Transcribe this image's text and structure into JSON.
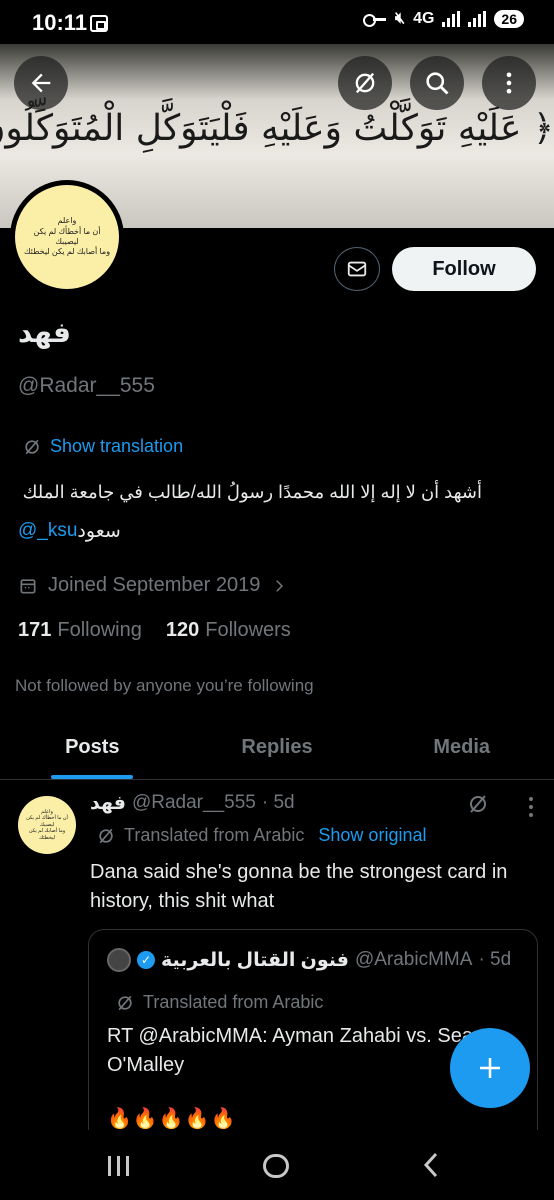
{
  "status_bar": {
    "time": "10:11",
    "network": "4G",
    "battery": "26"
  },
  "banner": {
    "calligraphy": "﴿ عَلَيْهِ تَوَكَّلْتُ وَعَلَيْهِ فَلْيَتَوَكَّلِ الْمُتَوَكِّلُونَ ﴾"
  },
  "avatar": {
    "line1": "واعلم",
    "line2": "أن ما أخطأك لم يكن ليصيبك",
    "line3": "وما أصابك لم يكن ليخطئك"
  },
  "profile": {
    "follow_label": "Follow",
    "name": "فهد",
    "handle": "@Radar__555",
    "show_translation": "Show translation",
    "bio_line1": "أشهد أن لا إله إلا الله محمدًا رسولُ الله/طالب في جامعة الملك",
    "bio_mention": "@_ksu",
    "bio_line2_suffix": "سعود",
    "joined": "Joined September 2019",
    "following_count": "171",
    "following_label": "Following",
    "followers_count": "120",
    "followers_label": "Followers",
    "not_followed": "Not followed by anyone you’re following"
  },
  "tabs": [
    {
      "label": "Posts",
      "active": true
    },
    {
      "label": "Replies",
      "active": false
    },
    {
      "label": "Media",
      "active": false
    }
  ],
  "tweet": {
    "name": "فهد",
    "handle": "@Radar__555",
    "time": "· 5d",
    "translated_from": "Translated from Arabic",
    "show_original": "Show original",
    "text": "Dana said she's gonna be the strongest card in history, this shit what"
  },
  "quote": {
    "name": "فنون القتال بالعربية",
    "handle": "@ArabicMMA",
    "time": "· 5d",
    "translated_from": "Translated from Arabic",
    "text": "RT @ArabicMMA: Ayman Zahabi vs. Sean O'Malley",
    "emoji": "🔥🔥🔥🔥🔥"
  },
  "colors": {
    "accent": "#1d9bf0",
    "background": "#000000",
    "secondary_text": "#71767b",
    "primary_text": "#e7e9ea"
  }
}
